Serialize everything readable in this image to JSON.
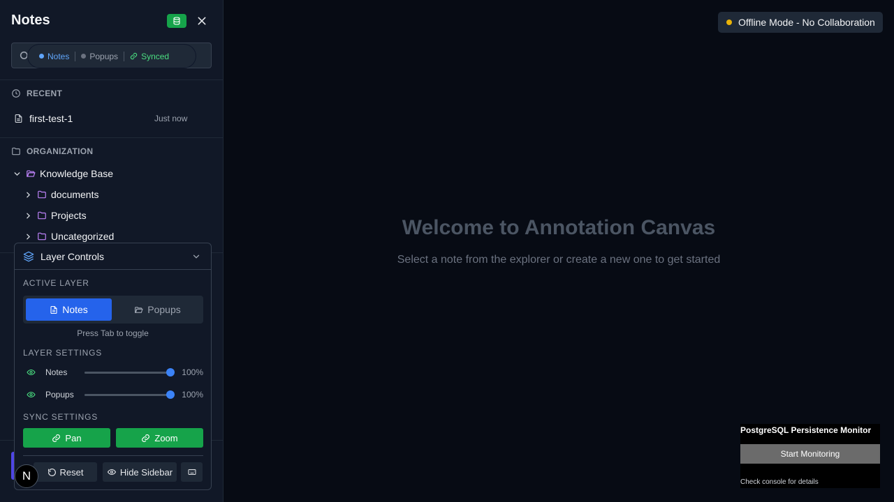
{
  "sidebar": {
    "title": "Notes",
    "db_icon": "database-icon",
    "close_icon": "close-icon",
    "search_icon": "search-icon",
    "filter": {
      "notes_label": "Notes",
      "popups_label": "Popups",
      "synced_label": "Synced"
    },
    "recent": {
      "label": "RECENT",
      "items": [
        {
          "name": "first-test-1",
          "time": "Just now"
        }
      ]
    },
    "organization": {
      "label": "ORGANIZATION",
      "root": "Knowledge Base",
      "children": [
        "documents",
        "Projects",
        "Uncategorized"
      ]
    }
  },
  "layer_controls": {
    "title": "Layer Controls",
    "active_layer_label": "ACTIVE LAYER",
    "notes_tab": "Notes",
    "popups_tab": "Popups",
    "hint": "Press Tab to toggle",
    "settings_label": "LAYER SETTINGS",
    "layers": [
      {
        "name": "Notes",
        "opacity": 100,
        "opacity_text": "100%"
      },
      {
        "name": "Popups",
        "opacity": 100,
        "opacity_text": "100%"
      }
    ],
    "sync_label": "SYNC SETTINGS",
    "pan_label": "Pan",
    "zoom_label": "Zoom",
    "reset_label": "Reset",
    "hide_sidebar_label": "Hide Sidebar"
  },
  "avatar_letter": "N",
  "status": {
    "text": "Offline Mode - No Collaboration",
    "color": "#eab308"
  },
  "canvas": {
    "title": "Welcome to Annotation Canvas",
    "subtitle": "Select a note from the explorer or create a new one to get started"
  },
  "monitor": {
    "title": "PostgreSQL Persistence Monitor",
    "button": "Start Monitoring",
    "note": "Check console for details"
  },
  "colors": {
    "accent": "#2563eb",
    "success": "#16a34a",
    "folder": "#c084fc"
  }
}
